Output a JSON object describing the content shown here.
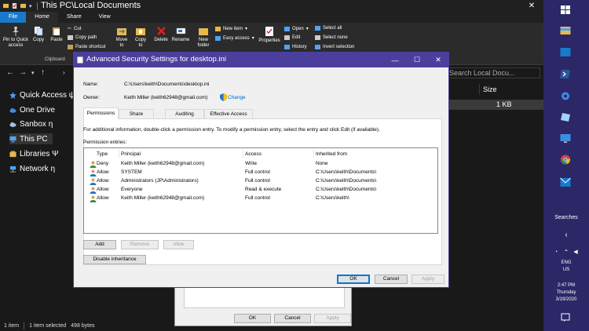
{
  "explorer": {
    "title": "This PC\\Local Documents",
    "ribbon_tabs": [
      "File",
      "Home",
      "Share",
      "View"
    ],
    "ribbon": {
      "pin": "Pin to Quick access",
      "copy": "Copy",
      "paste": "Paste",
      "cut": "Cut",
      "copy_path": "Copy path",
      "paste_shortcut": "Paste shortcut",
      "move_to": "Move to",
      "copy_to": "Copy to",
      "delete": "Delete",
      "rename": "Rename",
      "new_folder": "New folder",
      "new_item": "New item",
      "easy_access": "Easy access",
      "properties": "Properties",
      "open": "Open",
      "edit": "Edit",
      "history": "History",
      "select_all": "Select all",
      "select_none": "Select none",
      "invert_selection": "Invert selection",
      "clipboard_group": "Clipboard"
    },
    "search_placeholder": "Search Local Docu...",
    "column_size": "Size",
    "row_size": "1 KB",
    "sidebar": [
      {
        "label": "Quick Access ψ",
        "icon": "star-icon",
        "color": "#4fa3f7"
      },
      {
        "label": "One Drive",
        "icon": "cloud-icon",
        "color": "#3b8ee5"
      },
      {
        "label": "Sanbox η",
        "icon": "cloud-icon",
        "color": "#9fc4ea"
      },
      {
        "label": "This PC",
        "icon": "computer-icon",
        "color": "#4fa3f7"
      },
      {
        "label": "Libraries Ψ",
        "icon": "library-icon",
        "color": "#e8b84a"
      },
      {
        "label": "Network η",
        "icon": "network-icon",
        "color": "#4fa3f7"
      }
    ],
    "status": {
      "items": "1 item",
      "selected": "1 item selected",
      "size": "498 bytes"
    }
  },
  "taskbar": {
    "searches": "Searches",
    "lang1": "ENG",
    "lang2": "US",
    "time": "2:47 PM",
    "day": "Thursday",
    "date": "3/19/2020"
  },
  "bg_dialog": {
    "ok": "OK",
    "cancel": "Cancel",
    "apply": "Apply"
  },
  "dialog": {
    "title": "Advanced Security Settings for desktop.ini",
    "name_label": "Name:",
    "name_value": "C:\\Users\\keith\\Documents\\desktop.ini",
    "owner_label": "Owner:",
    "owner_value": "Keith Miller (keith62948@gmail.com)",
    "change_link": "Change",
    "tabs": [
      "Permissions",
      "Share",
      "Auditing",
      "Effective Access"
    ],
    "info_text": "For additional information, double-click a permission entry. To modify a permission entry, select the entry and click Edit (if available).",
    "entries_label": "Permission entries:",
    "columns": [
      "Type",
      "Principal",
      "Access",
      "Inherited from"
    ],
    "rows": [
      {
        "type": "Deny",
        "principal": "Keith Miller (keith62948@gmail.com)",
        "access": "Write",
        "inherited": "None"
      },
      {
        "type": "Allow",
        "principal": "SYSTEM",
        "access": "Full control",
        "inherited": "C:\\Users\\keith\\Documents\\"
      },
      {
        "type": "Allow",
        "principal": "Administrators (JP\\Administrators)",
        "access": "Full control",
        "inherited": "C:\\Users\\keith\\Documents\\"
      },
      {
        "type": "Allow",
        "principal": "Everyone",
        "access": "Read & execute",
        "inherited": "C:\\Users\\keith\\Documents\\"
      },
      {
        "type": "Allow",
        "principal": "Keith Miller (keith62948@gmail.com)",
        "access": "Full control",
        "inherited": "C:\\Users\\keith\\"
      }
    ],
    "add": "Add",
    "remove": "Remove",
    "view": "View",
    "disable_inheritance": "Disable inheritance",
    "ok": "OK",
    "cancel": "Cancel",
    "apply": "Apply"
  }
}
